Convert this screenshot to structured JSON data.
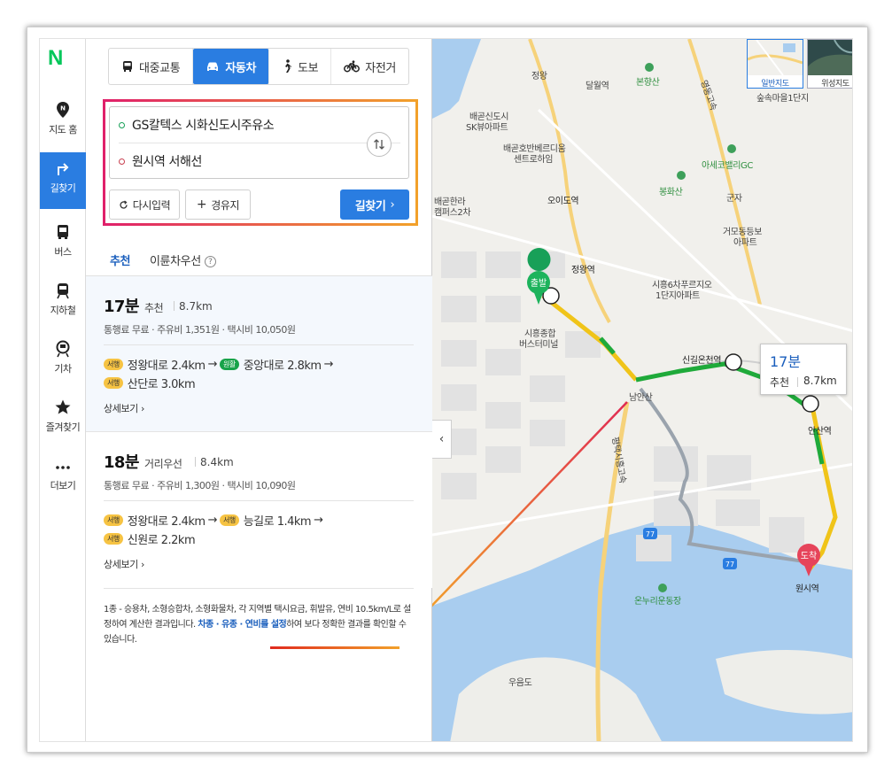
{
  "logo": "N",
  "nav": {
    "items": [
      {
        "label": "지도 홈",
        "icon": "map-pin-icon"
      },
      {
        "label": "길찾기",
        "icon": "directions-icon"
      },
      {
        "label": "버스",
        "icon": "bus-icon"
      },
      {
        "label": "지하철",
        "icon": "subway-icon"
      },
      {
        "label": "기차",
        "icon": "train-icon"
      },
      {
        "label": "즐겨찾기",
        "icon": "star-icon"
      },
      {
        "label": "더보기",
        "icon": "more-icon"
      }
    ]
  },
  "modes": [
    {
      "label": "대중교통",
      "icon": "bus-icon"
    },
    {
      "label": "자동차",
      "icon": "car-icon"
    },
    {
      "label": "도보",
      "icon": "walk-icon"
    },
    {
      "label": "자전거",
      "icon": "bike-icon"
    }
  ],
  "route": {
    "start": "GS칼텍스 시화신도시주유소",
    "end": "원시역 서해선"
  },
  "buttons": {
    "reset": "다시입력",
    "waypoint": "경유지",
    "search": "길찾기"
  },
  "tabs": {
    "recommend": "추천",
    "eco": "이륜차우선"
  },
  "routes": [
    {
      "time": "17분",
      "tag": "추천",
      "distance": "8.7km",
      "cost": "통행료 무료 · 주유비 1,351원 · 택시비 10,050원",
      "roads_line1": [
        {
          "badge": "서행",
          "name": "정왕대로 2.4km"
        },
        {
          "badge": "원활",
          "name": "중앙대로 2.8km"
        }
      ],
      "roads_line2": [
        {
          "badge": "서행",
          "name": "산단로 3.0km"
        }
      ],
      "detail": "상세보기"
    },
    {
      "time": "18분",
      "tag": "거리우선",
      "distance": "8.4km",
      "cost": "통행료 무료 · 주유비 1,300원 · 택시비 10,090원",
      "roads_line1": [
        {
          "badge": "서행",
          "name": "정왕대로 2.4km"
        },
        {
          "badge": "서행",
          "name": "능길로 1.4km"
        }
      ],
      "roads_line2": [
        {
          "badge": "서행",
          "name": "신원로 2.2km"
        }
      ],
      "detail": "상세보기"
    }
  ],
  "notice": {
    "text1": "1종 - 승용차, 소형승합차, 소형화물차, 각 지역별 택시요금, 휘발유, 연비 10.5km/L로 설정하여 계산한 결과입니다. ",
    "link": "차종 · 유종 · 연비를 설정",
    "text2": "하여 보다 정확한 결과를 확인할 수 있습니다."
  },
  "map": {
    "map_types": {
      "standard": "일반지도",
      "satellite": "위성지도"
    },
    "callout": {
      "time": "17분",
      "tag": "추천",
      "distance": "8.7km"
    },
    "start_marker": "출발",
    "end_marker": "도착",
    "labels": {
      "jeongwang_ic": "정왕",
      "dalwol": "달월역",
      "bonghyangsan": "본향산",
      "baegot_sk": "배곧신도시\nSK뷰아파트",
      "baegot_center": "배곧호반베르디움\n센트로하임",
      "soopmaeul": "숲속마을1단지",
      "aseko": "아세코밸리GC",
      "bonghwasan": "봉화산",
      "oido": "오이도역",
      "gunja": "군자",
      "baegot_hanra": "배곧한라\n캠퍼스2차",
      "geomo": "거모동등보\n아파트",
      "jeongwang_st": "정왕역",
      "siheung6": "시흥6차푸르지오\n1단지아파트",
      "siheung_bus": "시흥종합\n버스터미널",
      "singil": "신길온천역",
      "ansan": "안산역",
      "namansan_ic": "남안산",
      "pyeongtaek_highway": "평택시흥고속",
      "donuri": "온누리운동장",
      "wonsi": "원시역",
      "umdo": "우음도",
      "route_77": "77",
      "yeongdong_highway": "영동고속"
    }
  },
  "colors": {
    "accent": "#2a7de1",
    "logo": "#03c75a",
    "route_slow": "#f0c419",
    "route_fast": "#1faa3a",
    "route_alt": "#9aa3ad",
    "highlight_box_start": "#e0206a",
    "highlight_box_end": "#f2a12a"
  }
}
